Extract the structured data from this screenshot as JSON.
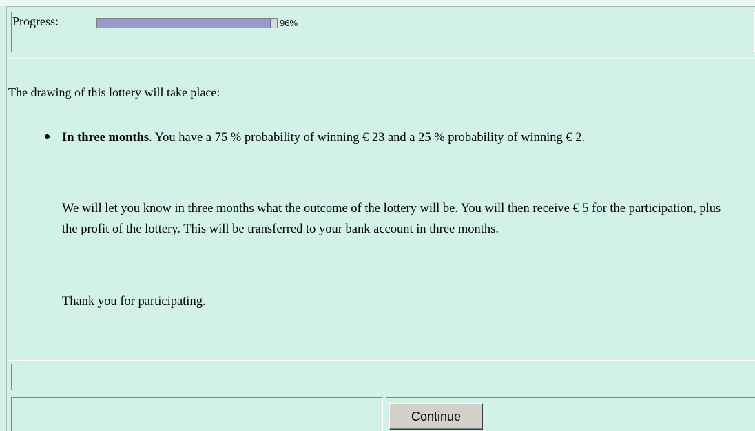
{
  "progress": {
    "label": "Progress:",
    "percent_text": "96%",
    "fraction": 0.96
  },
  "content": {
    "intro": "The drawing of this lottery will take place:",
    "item": {
      "title": "In three months",
      "line1_rest": ". You have a 75 % probability of winning € 23 and a 25 % probability of winning € 2.",
      "paragraph2": "We will let you know in three months what the outcome of the lottery will be. You will then receive € 5 for the participation, plus the profit of the lottery. This will be transferred to your bank account in three months.",
      "paragraph3": "Thank you for participating."
    }
  },
  "footer": {
    "continue_label": "Continue"
  },
  "colors": {
    "page_background": "#d2f2e8",
    "progress_fill": "#9999cc",
    "button_face": "#d4d0c8"
  }
}
